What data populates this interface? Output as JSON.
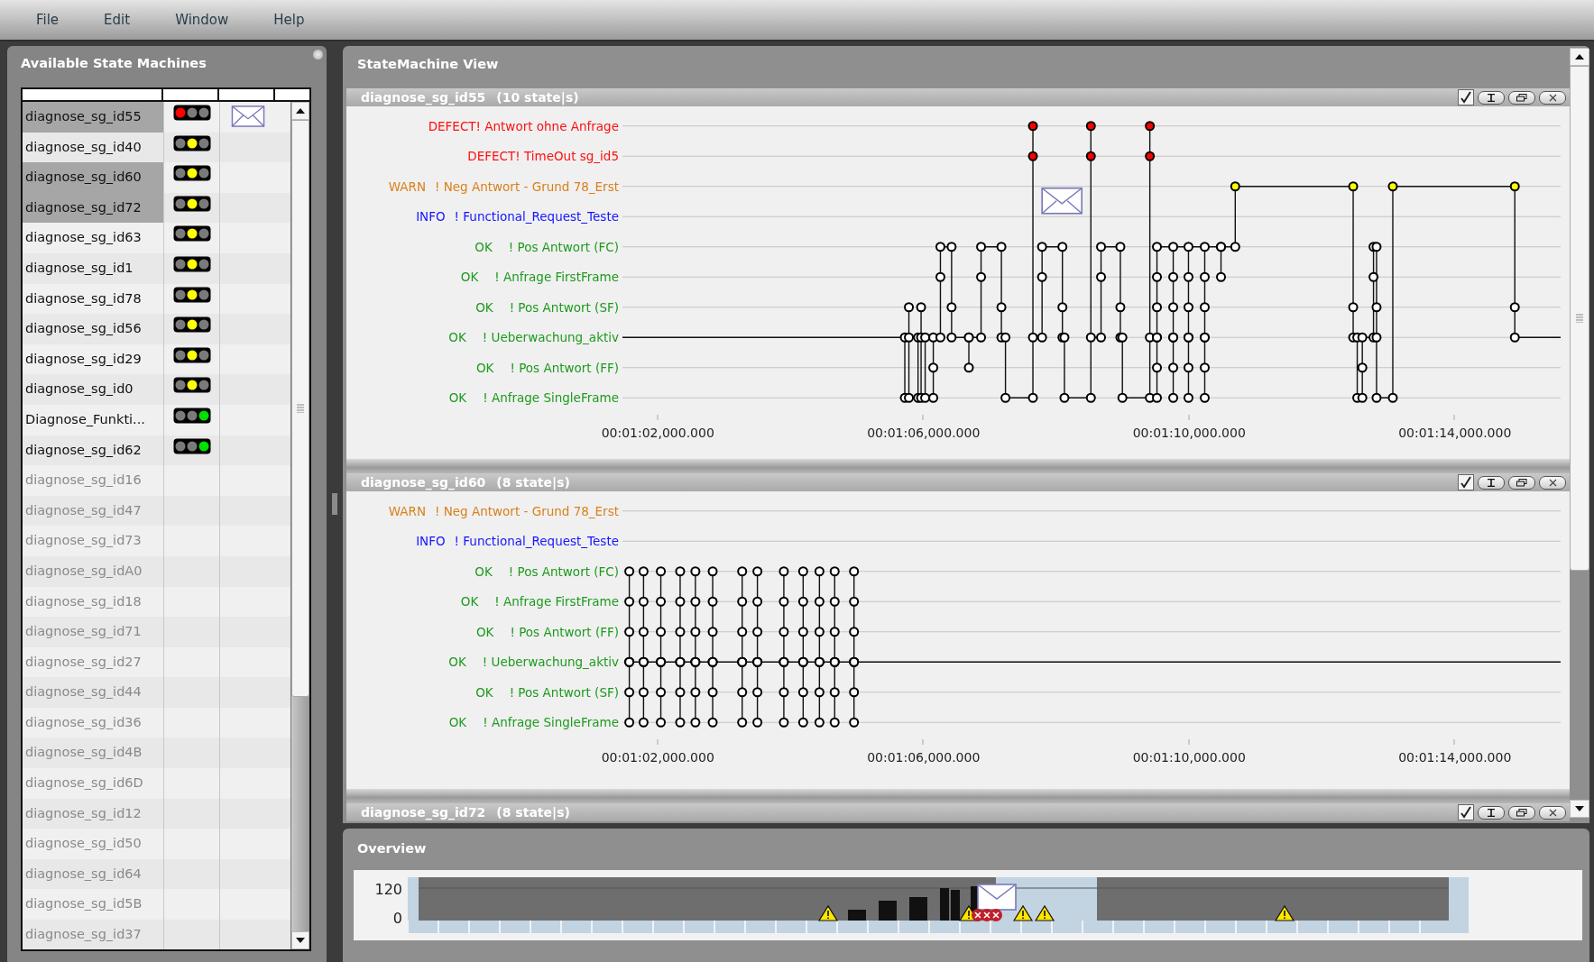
{
  "menu": [
    {
      "label": "File"
    },
    {
      "label": "Edit"
    },
    {
      "label": "Window"
    },
    {
      "label": "Help"
    }
  ],
  "machines_panel": {
    "title": "Available State Machines",
    "rows": [
      {
        "name": "diagnose_sg_id55",
        "selected": true,
        "enabled": true,
        "kind": "red",
        "message": true
      },
      {
        "name": "diagnose_sg_id40",
        "selected": false,
        "enabled": true,
        "kind": "yellow",
        "message": false
      },
      {
        "name": "diagnose_sg_id60",
        "selected": true,
        "enabled": true,
        "kind": "yellow",
        "message": false
      },
      {
        "name": "diagnose_sg_id72",
        "selected": true,
        "enabled": true,
        "kind": "yellow",
        "message": false
      },
      {
        "name": "diagnose_sg_id63",
        "selected": false,
        "enabled": true,
        "kind": "yellow",
        "message": false
      },
      {
        "name": "diagnose_sg_id1",
        "selected": false,
        "enabled": true,
        "kind": "yellow",
        "message": false
      },
      {
        "name": "diagnose_sg_id78",
        "selected": false,
        "enabled": true,
        "kind": "yellow",
        "message": false
      },
      {
        "name": "diagnose_sg_id56",
        "selected": false,
        "enabled": true,
        "kind": "yellow",
        "message": false
      },
      {
        "name": "diagnose_sg_id29",
        "selected": false,
        "enabled": true,
        "kind": "yellow",
        "message": false
      },
      {
        "name": "diagnose_sg_id0",
        "selected": false,
        "enabled": true,
        "kind": "yellow",
        "message": false
      },
      {
        "name": "Diagnose_Funkti...",
        "selected": false,
        "enabled": true,
        "kind": "green",
        "message": false
      },
      {
        "name": "diagnose_sg_id62",
        "selected": false,
        "enabled": true,
        "kind": "green",
        "message": false
      },
      {
        "name": "diagnose_sg_id16",
        "selected": false,
        "enabled": false,
        "message": false
      },
      {
        "name": "diagnose_sg_id47",
        "selected": false,
        "enabled": false,
        "message": false
      },
      {
        "name": "diagnose_sg_id73",
        "selected": false,
        "enabled": false,
        "message": false
      },
      {
        "name": "diagnose_sg_idA0",
        "selected": false,
        "enabled": false,
        "message": false
      },
      {
        "name": "diagnose_sg_id18",
        "selected": false,
        "enabled": false,
        "message": false
      },
      {
        "name": "diagnose_sg_id71",
        "selected": false,
        "enabled": false,
        "message": false
      },
      {
        "name": "diagnose_sg_id27",
        "selected": false,
        "enabled": false,
        "message": false
      },
      {
        "name": "diagnose_sg_id44",
        "selected": false,
        "enabled": false,
        "message": false
      },
      {
        "name": "diagnose_sg_id36",
        "selected": false,
        "enabled": false,
        "message": false
      },
      {
        "name": "diagnose_sg_id4B",
        "selected": false,
        "enabled": false,
        "message": false
      },
      {
        "name": "diagnose_sg_id6D",
        "selected": false,
        "enabled": false,
        "message": false
      },
      {
        "name": "diagnose_sg_id12",
        "selected": false,
        "enabled": false,
        "message": false
      },
      {
        "name": "diagnose_sg_id50",
        "selected": false,
        "enabled": false,
        "message": false
      },
      {
        "name": "diagnose_sg_id64",
        "selected": false,
        "enabled": false,
        "message": false
      },
      {
        "name": "diagnose_sg_id5B",
        "selected": false,
        "enabled": false,
        "message": false
      },
      {
        "name": "diagnose_sg_id37",
        "selected": false,
        "enabled": false,
        "message": false
      }
    ]
  },
  "view_panel": {
    "title": "StateMachine View",
    "views": [
      {
        "name": "diagnose_sg_id55",
        "count": "(10 state|s)",
        "checked": true,
        "states": [
          {
            "kind": "defect",
            "severity": "DEFECT",
            "name": "! Antwort ohne Anfrage"
          },
          {
            "kind": "defect",
            "severity": "DEFECT",
            "name": "! TimeOut sg_id5"
          },
          {
            "kind": "warn",
            "severity": "WARN",
            "name": "! Neg Antwort - Grund 78_Erst"
          },
          {
            "kind": "info",
            "severity": "INFO",
            "name": "! Functional_Request_Teste"
          },
          {
            "kind": "ok",
            "severity": "OK",
            "name": "! Pos Antwort (FC)"
          },
          {
            "kind": "ok",
            "severity": "OK",
            "name": "! Anfrage FirstFrame"
          },
          {
            "kind": "ok",
            "severity": "OK",
            "name": "! Pos Antwort (SF)"
          },
          {
            "kind": "ok",
            "severity": "OK",
            "name": "! Ueberwachung_aktiv"
          },
          {
            "kind": "ok",
            "severity": "OK",
            "name": "! Pos Antwort (FF)"
          },
          {
            "kind": "ok",
            "severity": "OK",
            "name": "! Anfrage SingleFrame"
          }
        ],
        "axis_labels": [
          "00:01:02,000.000",
          "00:01:06,000.000",
          "00:01:10,000.000",
          "00:01:14,000.000"
        ]
      },
      {
        "name": "diagnose_sg_id60",
        "count": "(8 state|s)",
        "checked": true,
        "states": [
          {
            "kind": "warn",
            "severity": "WARN",
            "name": "! Neg Antwort - Grund 78_Erst"
          },
          {
            "kind": "info",
            "severity": "INFO",
            "name": "! Functional_Request_Teste"
          },
          {
            "kind": "ok",
            "severity": "OK",
            "name": "! Pos Antwort (FC)"
          },
          {
            "kind": "ok",
            "severity": "OK",
            "name": "! Anfrage FirstFrame"
          },
          {
            "kind": "ok",
            "severity": "OK",
            "name": "! Pos Antwort (FF)"
          },
          {
            "kind": "ok",
            "severity": "OK",
            "name": "! Ueberwachung_aktiv"
          },
          {
            "kind": "ok",
            "severity": "OK",
            "name": "! Pos Antwort (SF)"
          },
          {
            "kind": "ok",
            "severity": "OK",
            "name": "! Anfrage SingleFrame"
          }
        ],
        "axis_labels": [
          "00:01:02,000.000",
          "00:01:06,000.000",
          "00:01:10,000.000",
          "00:01:14,000.000"
        ]
      },
      {
        "name": "diagnose_sg_id72",
        "count": "(8 state|s)",
        "checked": true
      }
    ]
  },
  "overview": {
    "title": "Overview",
    "y_labels": [
      "120",
      "0"
    ]
  }
}
